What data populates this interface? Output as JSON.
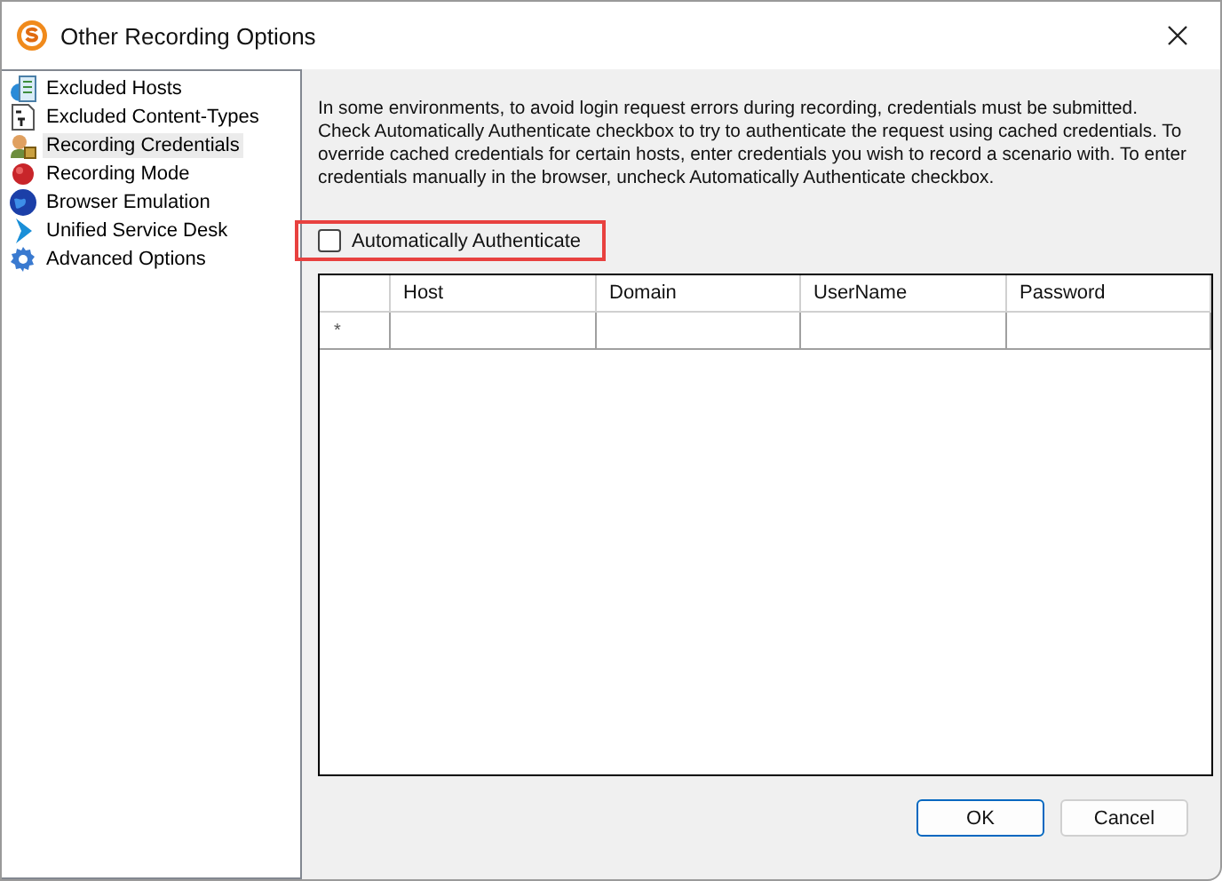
{
  "window": {
    "title": "Other Recording Options"
  },
  "sidebar": {
    "items": [
      {
        "label": "Excluded Hosts",
        "selected": false
      },
      {
        "label": "Excluded Content-Types",
        "selected": false
      },
      {
        "label": "Recording Credentials",
        "selected": true
      },
      {
        "label": "Recording Mode",
        "selected": false
      },
      {
        "label": "Browser Emulation",
        "selected": false
      },
      {
        "label": "Unified Service Desk",
        "selected": false
      },
      {
        "label": "Advanced Options",
        "selected": false
      }
    ]
  },
  "description": "In some environments, to avoid login request errors during recording, credentials must be submitted. Check Automatically Authenticate checkbox to try to authenticate the request using cached credentials. To override cached credentials for certain hosts, enter credentials you wish to record a scenario with. To enter credentials manually in the browser, uncheck Automatically Authenticate checkbox.",
  "auto_authenticate": {
    "label": "Automatically Authenticate",
    "checked": false,
    "highlighted": true
  },
  "table": {
    "columns": [
      "Host",
      "Domain",
      "UserName",
      "Password"
    ],
    "new_row_marker": "*"
  },
  "buttons": [
    {
      "label": "OK",
      "default": true
    },
    {
      "label": "Cancel",
      "default": false
    }
  ]
}
